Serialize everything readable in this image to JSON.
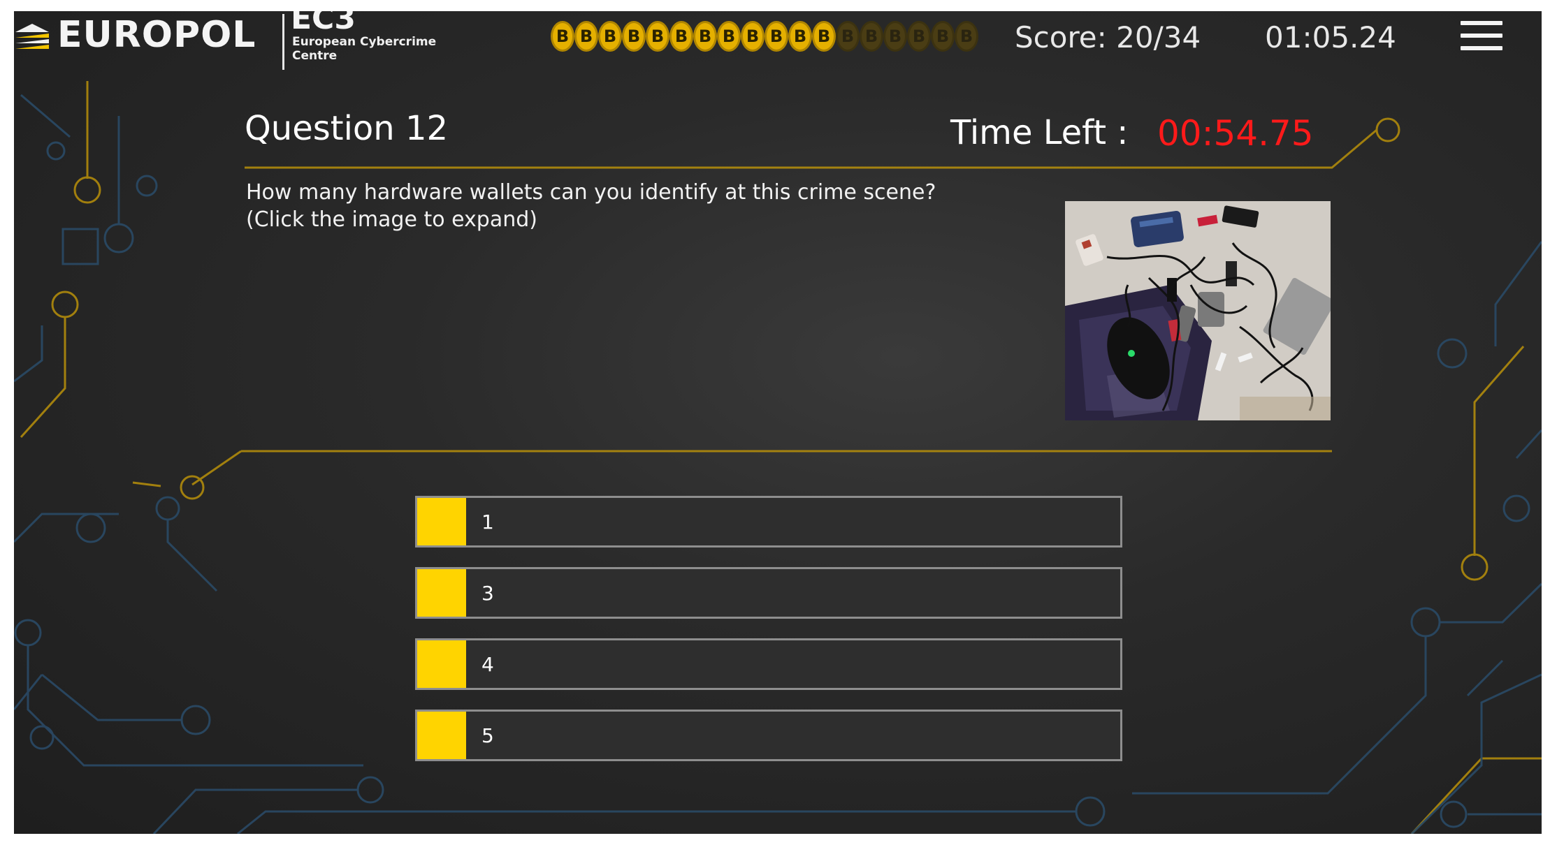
{
  "header": {
    "logo_text": "EUROPOL",
    "ec3_title": "EC3",
    "ec3_subtitle": "European Cybercrime Centre",
    "coin_glyph": "B",
    "coins_earned": 12,
    "coins_total": 18,
    "score_text": "Score: 20/34",
    "elapsed_time": "01:05.24",
    "menu_icon": "hamburger-menu-icon"
  },
  "question": {
    "title": "Question 12",
    "time_left_label": "Time Left :",
    "time_left_value": "00:54.75",
    "text_line1": "How many hardware wallets can you identify at this crime scene?",
    "text_line2": "(Click the image to expand)"
  },
  "answers": [
    {
      "label": "1"
    },
    {
      "label": "3"
    },
    {
      "label": "4"
    },
    {
      "label": "5"
    }
  ],
  "colors": {
    "accent_gold": "#e5b000",
    "answer_tab": "#ffd400",
    "timer_red": "#ff1a1a",
    "background": "#2a2a2a"
  }
}
